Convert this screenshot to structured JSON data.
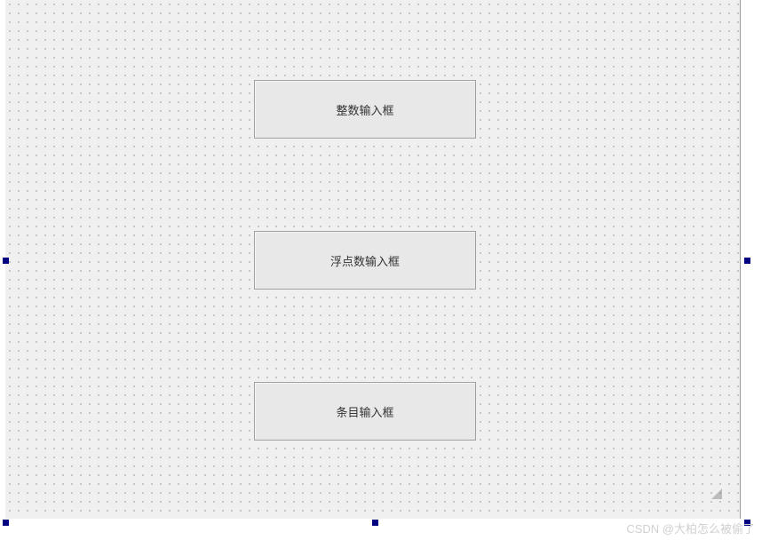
{
  "canvas": {
    "buttons": [
      {
        "label": "整数输入框"
      },
      {
        "label": "浮点数输入框"
      },
      {
        "label": "条目输入框"
      }
    ]
  },
  "watermark": {
    "text": "CSDN @大柏怎么被偷了"
  }
}
